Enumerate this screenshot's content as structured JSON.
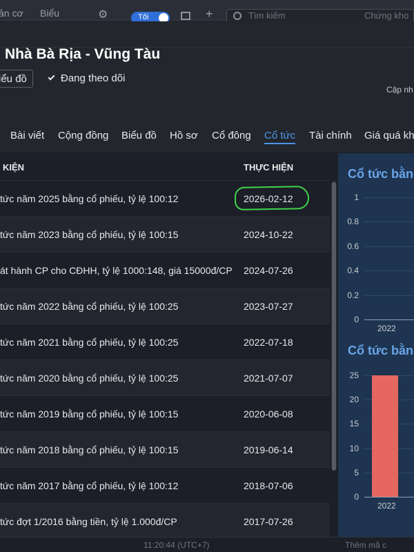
{
  "topbar": {
    "tab1": "ản cơ",
    "tab2": "Biểu",
    "toggle_label": "Tối",
    "search_placeholder": "Tìm kiếm",
    "search_hint": "Chứng kho"
  },
  "company": {
    "title": "Nhà Bà Rịa - Vũng Tàu",
    "chart_button": "Biểu đồ",
    "follow_label": "Đang theo dõi",
    "updated_label": "Cập nh"
  },
  "tabs": [
    "Bài viết",
    "Cộng đồng",
    "Biểu đồ",
    "Hồ sơ",
    "Cổ đông",
    "Cổ tức",
    "Tài chính",
    "Giá quá khứ"
  ],
  "active_tab": "Cổ tức",
  "table": {
    "col_event": "KIỆN",
    "col_date": "THỰC HIỆN",
    "rows": [
      {
        "desc": "tức năm 2025 bằng cổ phiếu, tỷ lệ 100:12",
        "date": "2026-02-12"
      },
      {
        "desc": "tức năm 2023 bằng cổ phiếu, tỷ lệ 100:15",
        "date": "2024-10-22"
      },
      {
        "desc": "át hành CP cho CĐHH, tỷ lệ 1000:148, giá 15000đ/CP",
        "date": "2024-07-26"
      },
      {
        "desc": "tức năm 2022 bằng cổ phiếu, tỷ lệ 100:25",
        "date": "2023-07-27"
      },
      {
        "desc": "tức năm 2021 bằng cổ phiếu, tỷ lệ 100:25",
        "date": "2022-07-18"
      },
      {
        "desc": "tức năm 2020 bằng cổ phiếu, tỷ lệ 100:25",
        "date": "2021-07-07"
      },
      {
        "desc": "tức năm 2019 bằng cổ phiếu, tỷ lệ 100:15",
        "date": "2020-06-08"
      },
      {
        "desc": "tức năm 2018 bằng cổ phiếu, tỷ lệ 100:15",
        "date": "2019-06-14"
      },
      {
        "desc": "tức năm 2017 bằng cổ phiếu, tỷ lệ 100:12",
        "date": "2018-07-06"
      },
      {
        "desc": "tức đợt 1/2016 bằng tiền, tỷ lệ 1.000đ/CP",
        "date": "2017-07-26"
      }
    ]
  },
  "charts": {
    "cash": {
      "title": "Cổ tức bằng",
      "yticks": [
        "1",
        "0.8",
        "0.6",
        "0.4",
        "0.2",
        "0"
      ],
      "xlabel": "2022"
    },
    "stock": {
      "title": "Cổ tức bằn",
      "yticks": [
        "25",
        "20",
        "15",
        "10",
        "5",
        "0"
      ],
      "xlabel": "2022",
      "bar_value": 25,
      "bar_color": "#e5675f"
    }
  },
  "status": {
    "time": "11:20:44 (UTC+7)",
    "add": "Thêm mã c"
  }
}
